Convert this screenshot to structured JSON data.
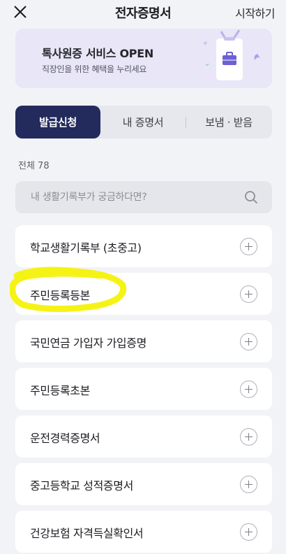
{
  "header": {
    "title": "전자증명서",
    "start_label": "시작하기"
  },
  "banner": {
    "title": "톡사원증 서비스 OPEN",
    "subtitle": "직장인을 위한 혜택을 누리세요"
  },
  "tabs": [
    {
      "label": "발급신청",
      "active": true
    },
    {
      "label": "내 증명서",
      "active": false
    },
    {
      "label": "보냄 · 받음",
      "active": false
    }
  ],
  "total_label": "전체 78",
  "search": {
    "placeholder": "내 생활기록부가 궁금하다면?",
    "value": ""
  },
  "items": [
    {
      "label": "학교생활기록부 (초중고)"
    },
    {
      "label": "주민등록등본"
    },
    {
      "label": "국민연금 가입자 가입증명"
    },
    {
      "label": "주민등록초본"
    },
    {
      "label": "운전경력증명서"
    },
    {
      "label": "중고등학교 성적증명서"
    },
    {
      "label": "건강보험 자격득실확인서"
    }
  ],
  "colors": {
    "background": "#f2f3f6",
    "banner_bg": "#e8e6f7",
    "active_tab": "#232a5c",
    "highlight": "#f4f20a"
  },
  "icons": {
    "close": "close-icon",
    "search": "search-icon",
    "add": "plus-circle-icon",
    "banner": "id-badge-icon"
  }
}
